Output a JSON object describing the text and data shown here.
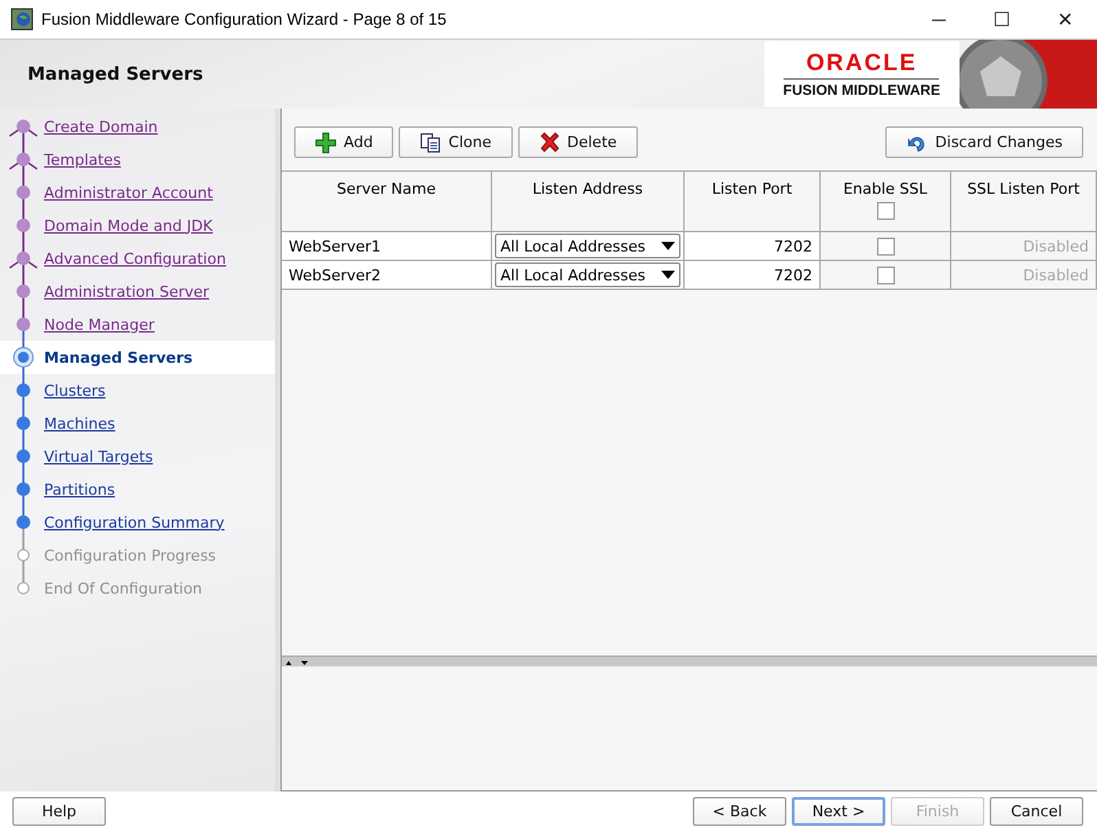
{
  "window": {
    "title": "Fusion Middleware Configuration Wizard - Page 8 of 15",
    "controls": [
      "─",
      "☐",
      "✕"
    ]
  },
  "header": {
    "title": "Managed Servers",
    "logo_top": "ORACLE",
    "logo_bottom": "FUSION MIDDLEWARE"
  },
  "steps": [
    {
      "label": "Create Domain",
      "visited": true,
      "selected": false,
      "disabled": false,
      "branch": true
    },
    {
      "label": "Templates",
      "visited": true,
      "selected": false,
      "disabled": false,
      "branch": true
    },
    {
      "label": "Administrator Account",
      "visited": true,
      "selected": false,
      "disabled": false,
      "branch": false
    },
    {
      "label": "Domain Mode and JDK",
      "visited": true,
      "selected": false,
      "disabled": false,
      "branch": false
    },
    {
      "label": "Advanced Configuration",
      "visited": true,
      "selected": false,
      "disabled": false,
      "branch": true
    },
    {
      "label": "Administration Server",
      "visited": true,
      "selected": false,
      "disabled": false,
      "branch": false
    },
    {
      "label": "Node Manager",
      "visited": true,
      "selected": false,
      "disabled": false,
      "branch": false
    },
    {
      "label": "Managed Servers",
      "visited": false,
      "selected": true,
      "disabled": false,
      "branch": false
    },
    {
      "label": "Clusters",
      "visited": false,
      "selected": false,
      "disabled": false,
      "branch": false
    },
    {
      "label": "Machines",
      "visited": false,
      "selected": false,
      "disabled": false,
      "branch": false
    },
    {
      "label": "Virtual Targets",
      "visited": false,
      "selected": false,
      "disabled": false,
      "branch": false
    },
    {
      "label": "Partitions",
      "visited": false,
      "selected": false,
      "disabled": false,
      "branch": false
    },
    {
      "label": "Configuration Summary",
      "visited": false,
      "selected": false,
      "disabled": false,
      "branch": false
    },
    {
      "label": "Configuration Progress",
      "visited": false,
      "selected": false,
      "disabled": true,
      "branch": false
    },
    {
      "label": "End Of Configuration",
      "visited": false,
      "selected": false,
      "disabled": true,
      "branch": false
    }
  ],
  "toolbar": [
    {
      "label": "Add",
      "kind": "add"
    },
    {
      "label": "Clone",
      "kind": "clone"
    },
    {
      "label": "Delete",
      "kind": "delete"
    }
  ],
  "discard_button": {
    "label": "Discard Changes"
  },
  "table": {
    "columns": [
      "Server Name",
      "Listen Address",
      "Listen Port",
      "Enable SSL",
      "SSL Listen Port"
    ],
    "header_ssl_checked": false,
    "rows": [
      {
        "server_name": "WebServer1",
        "listen_address": "All Local Addresses",
        "listen_port": "7202",
        "enable_ssl": false,
        "ssl_listen_port": "Disabled"
      },
      {
        "server_name": "WebServer2",
        "listen_address": "All Local Addresses",
        "listen_port": "7202",
        "enable_ssl": false,
        "ssl_listen_port": "Disabled"
      }
    ]
  },
  "buttons": [
    {
      "label": "Help",
      "kind": "help",
      "disabled": false,
      "selected": false
    },
    {
      "label": "< Back",
      "kind": "nav",
      "disabled": false,
      "selected": false
    },
    {
      "label": "Next >",
      "kind": "nav",
      "disabled": false,
      "selected": true
    },
    {
      "label": "Finish",
      "kind": "nav",
      "disabled": true,
      "selected": false
    },
    {
      "label": "Cancel",
      "kind": "nav",
      "disabled": false,
      "selected": false
    }
  ]
}
